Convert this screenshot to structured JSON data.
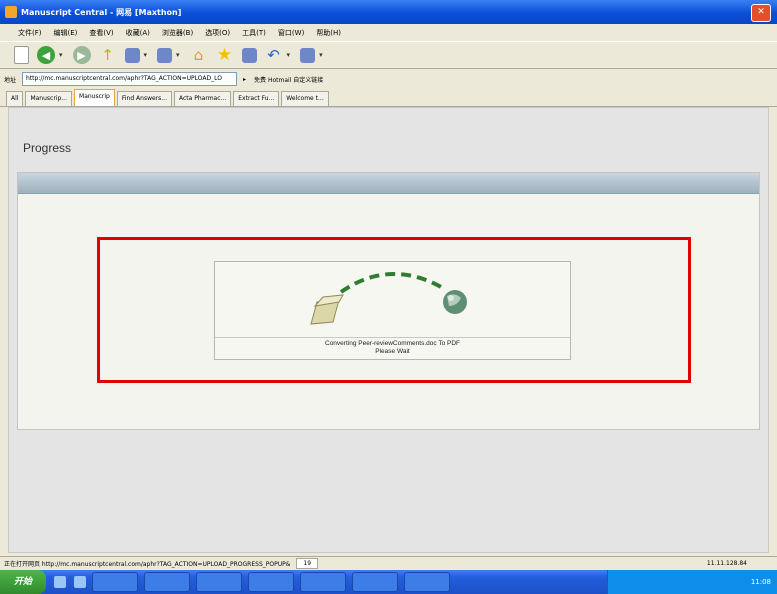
{
  "window": {
    "title": "Manuscript Central - 网易 [Maxthon]"
  },
  "menu": {
    "items": [
      "文件(F)",
      "编辑(E)",
      "查看(V)",
      "收藏(A)",
      "浏览器(B)",
      "选项(O)",
      "工具(T)",
      "窗口(W)",
      "帮助(H)"
    ]
  },
  "address": {
    "label": "地址",
    "url": "http://mc.manuscriptcentral.com/aphr?TAG_ACTION=UPLOAD_LO",
    "extra": "免费 Hotmail   自定义链接"
  },
  "tabs": [
    {
      "label": "All",
      "active": false
    },
    {
      "label": "Manuscrip...",
      "active": false
    },
    {
      "label": "Manuscrip",
      "active": true
    },
    {
      "label": "Find Answers...",
      "active": false
    },
    {
      "label": "Acta Pharmac...",
      "active": false
    },
    {
      "label": "Extract Fu...",
      "active": false
    },
    {
      "label": "Welcome t...",
      "active": false
    }
  ],
  "page": {
    "title": "Progress"
  },
  "progress": {
    "line1": "Converting Peer-reviewComments.doc To PDF",
    "line2": "Please Wait"
  },
  "status": {
    "text": "正在打开网页 http://mc.manuscriptcentral.com/aphr?TAG_ACTION=UPLOAD_PROGRESS_POPUP&",
    "num": "19",
    "right": "11.11.128.84"
  },
  "taskbar": {
    "start_label": "开始",
    "clock": "11:08"
  },
  "colors": {
    "highlight": "#e30000",
    "arc": "#2f7d32"
  }
}
